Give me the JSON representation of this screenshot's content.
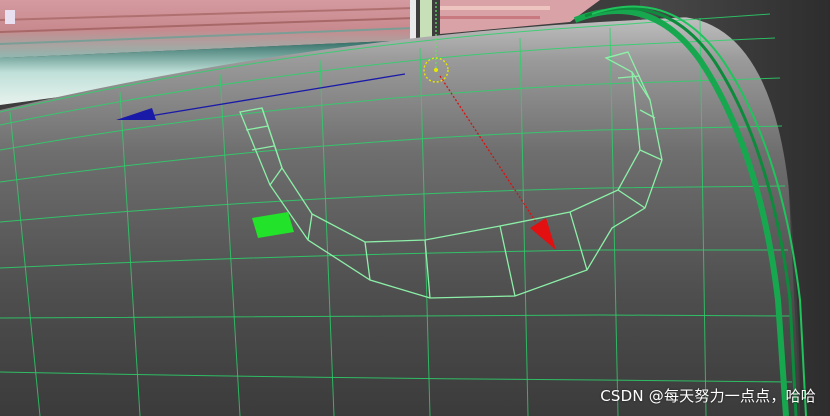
{
  "viewport": {
    "description_label": "",
    "colors": {
      "wireframe": "#2bd36a",
      "selection": "#8cf0a8",
      "cylinder_rim": "#17a84f",
      "axis_x": "#1a1aa8",
      "axis_z": "#d81010",
      "gizmo_center": "#e8e800",
      "face_marker": "#22e22a",
      "background_top": "#c9c9c9",
      "background_bottom": "#3b3b3b"
    },
    "icons": {
      "move_gizmo": "translate-gizmo-icon",
      "x_axis_arrow": "arrow-left-icon",
      "z_axis_arrow": "arrow-down-icon"
    }
  },
  "watermark": {
    "text": "CSDN @每天努力一点点，哈哈"
  }
}
